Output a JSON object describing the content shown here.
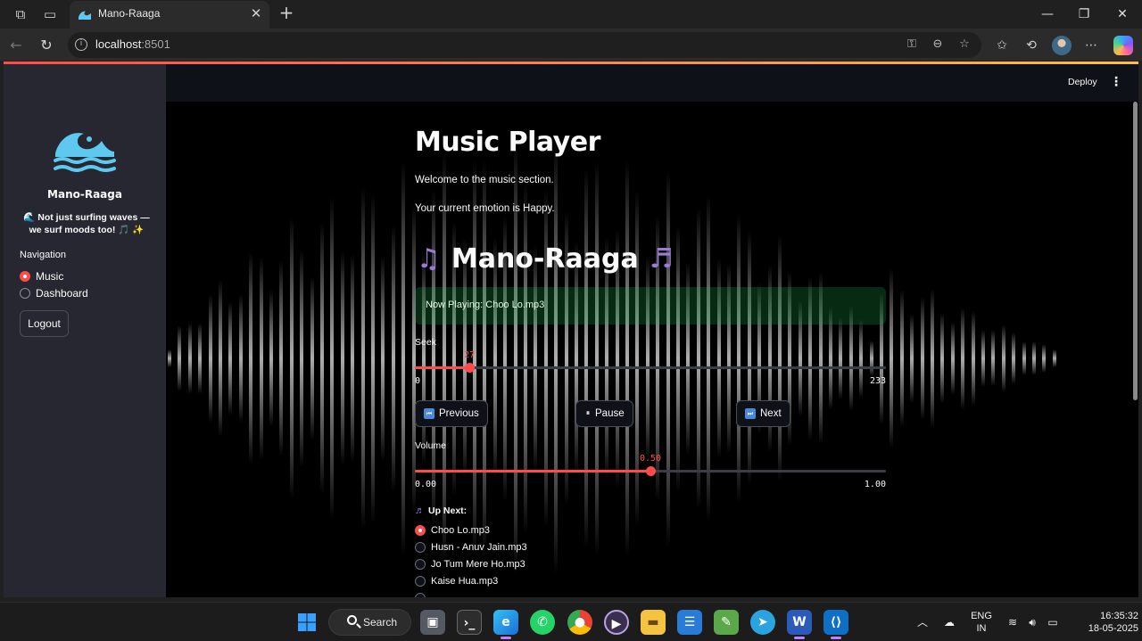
{
  "browser": {
    "tab_title": "Mano-Raaga",
    "url_host": "localhost",
    "url_port": ":8501"
  },
  "app": {
    "header": {
      "deploy_label": "Deploy"
    },
    "sidebar": {
      "brand": "Mano-Raaga",
      "tagline": "🌊 Not just surfing waves — we surf moods too! 🎵 ✨",
      "nav_label": "Navigation",
      "nav_items": [
        {
          "label": "Music",
          "selected": true
        },
        {
          "label": "Dashboard",
          "selected": false
        }
      ],
      "logout_label": "Logout"
    },
    "main": {
      "title": "Music Player",
      "welcome": "Welcome to the music section.",
      "emotion": "Your current emotion is Happy.",
      "brand_heading": "Mano-Raaga",
      "now_playing": "Now Playing: Choo Lo.mp3",
      "seek": {
        "label": "Seek",
        "value": "27",
        "min": "0",
        "max": "233",
        "fraction": 0.1159
      },
      "buttons": {
        "previous": "Previous",
        "pause": "Pause",
        "next": "Next"
      },
      "volume": {
        "label": "Volume",
        "value": "0.50",
        "min": "0.00",
        "max": "1.00",
        "fraction": 0.5
      },
      "up_next_label": "Up Next:",
      "playlist": [
        {
          "label": "Choo Lo.mp3",
          "selected": true
        },
        {
          "label": "Husn - Anuv Jain.mp3",
          "selected": false
        },
        {
          "label": "Jo Tum Mere Ho.mp3",
          "selected": false
        },
        {
          "label": "Kaise Hua.mp3",
          "selected": false
        }
      ]
    }
  },
  "taskbar": {
    "search_label": "Search",
    "lang_line1": "ENG",
    "lang_line2": "IN",
    "time": "16:35:32",
    "date": "18-05-2025"
  },
  "colors": {
    "accent": "#ff4b4b",
    "sidebar_bg": "#262730",
    "header_bg": "#0e1117",
    "success_bg": "#1c4f2c"
  }
}
